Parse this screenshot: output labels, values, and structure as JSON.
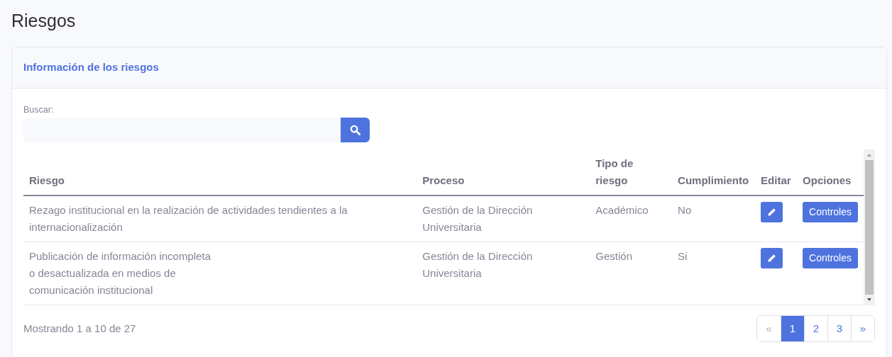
{
  "page_title": "Riesgos",
  "card": {
    "title": "Información de los riesgos",
    "search": {
      "label": "Buscar:"
    },
    "table": {
      "columns": [
        "Riesgo",
        "Proceso",
        "Tipo de riesgo",
        "Cumplimiento",
        "Editar",
        "Opciones"
      ],
      "rows": [
        {
          "riesgo": "Rezago institucional en la realización de actividades tendientes a la internacionalización",
          "proceso": "Gestión de la Dirección Universitaria",
          "tipo": "Académico",
          "cumplimiento": "No",
          "option": "Controles"
        },
        {
          "riesgo": "Publicación de información incompleta\no desactualizada en medios de\ncomunicación institucional",
          "proceso": "Gestión de la Dirección Universitaria",
          "tipo": "Gestión",
          "cumplimiento": "Si",
          "option": "Controles"
        }
      ]
    },
    "summary": "Mostrando 1 a 10 de 27",
    "pagination": [
      {
        "label": "«",
        "selected": false,
        "disabled": true
      },
      {
        "label": "1",
        "selected": true,
        "disabled": false
      },
      {
        "label": "2",
        "selected": false,
        "disabled": false
      },
      {
        "label": "3",
        "selected": false,
        "disabled": false
      },
      {
        "label": "»",
        "selected": false,
        "disabled": false
      }
    ]
  }
}
